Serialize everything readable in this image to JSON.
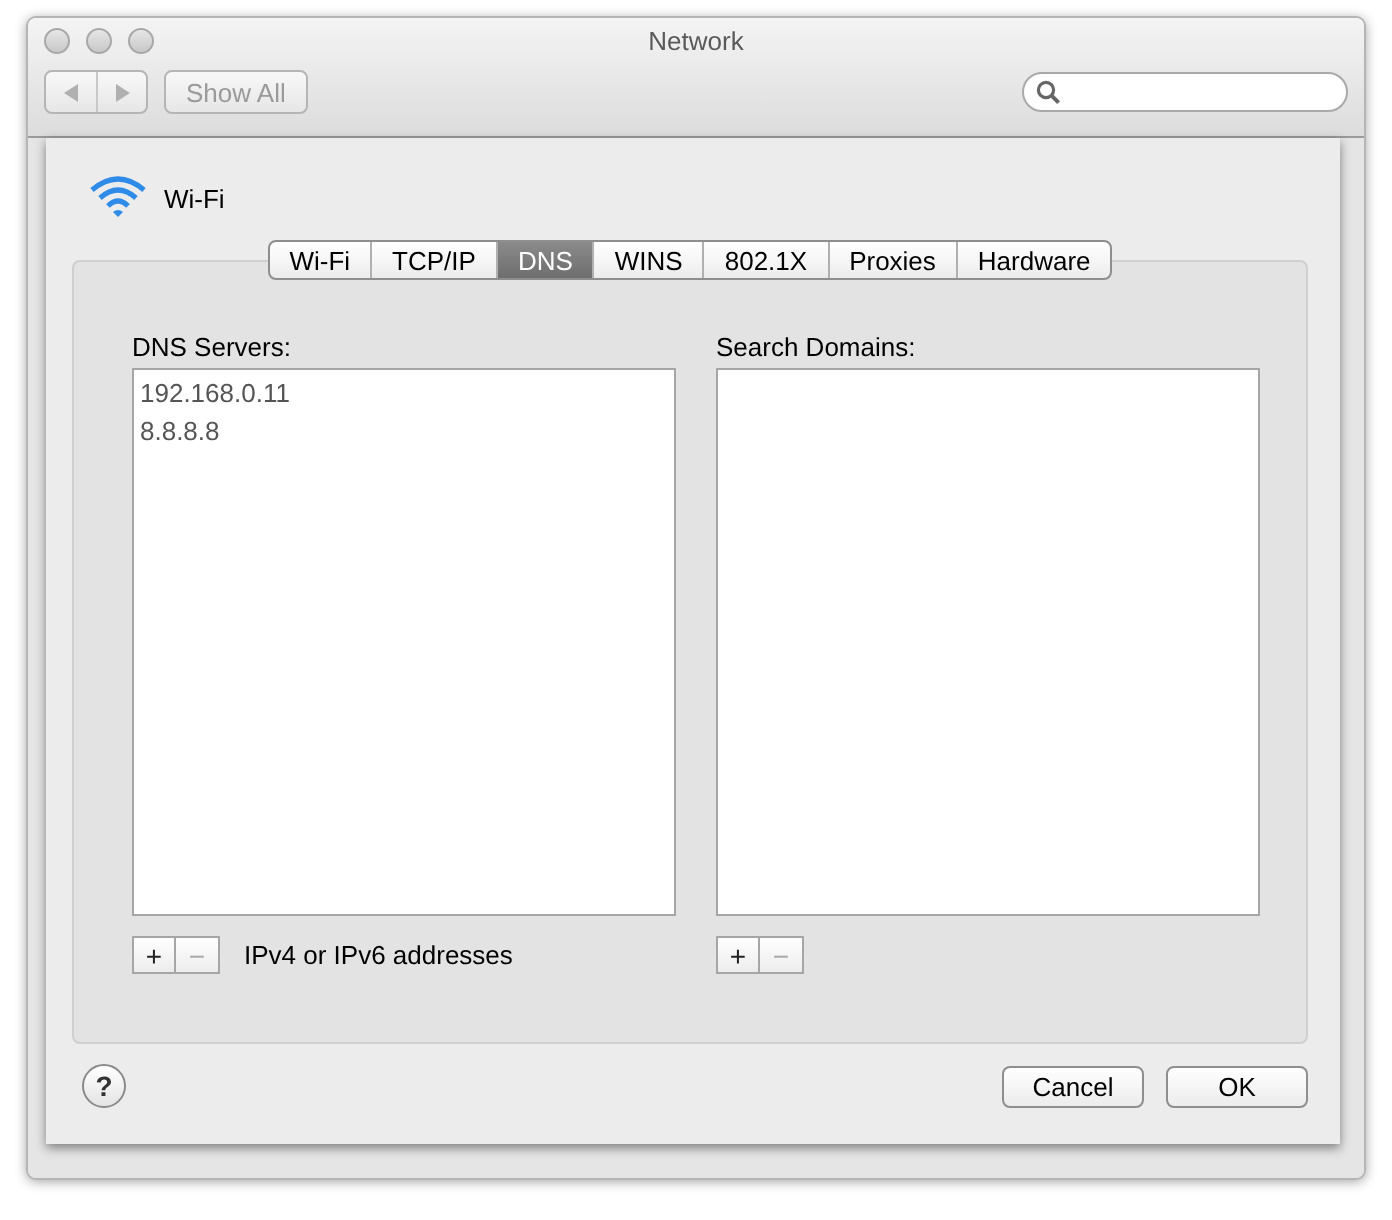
{
  "window": {
    "title": "Network"
  },
  "toolbar": {
    "show_all": "Show All",
    "search": {
      "focused": false
    }
  },
  "sheet": {
    "service": "Wi-Fi",
    "tabs": [
      {
        "label": "Wi-Fi",
        "selected": false
      },
      {
        "label": "TCP/IP",
        "selected": false
      },
      {
        "label": "DNS",
        "selected": true
      },
      {
        "label": "WINS",
        "selected": false
      },
      {
        "label": "802.1X",
        "selected": false
      },
      {
        "label": "Proxies",
        "selected": false
      },
      {
        "label": "Hardware",
        "selected": false
      }
    ],
    "lists": [
      {
        "label": "DNS Servers:",
        "entries": [
          "192.168.0.11",
          "8.8.8.8"
        ],
        "add": "+",
        "remove": "−",
        "remove_disabled": true,
        "hint": "IPv4 or IPv6 addresses"
      },
      {
        "label": "Search Domains:",
        "add": "+",
        "remove": "−",
        "remove_disabled": true
      }
    ],
    "help": "?",
    "buttons": [
      "Cancel",
      "OK"
    ]
  }
}
